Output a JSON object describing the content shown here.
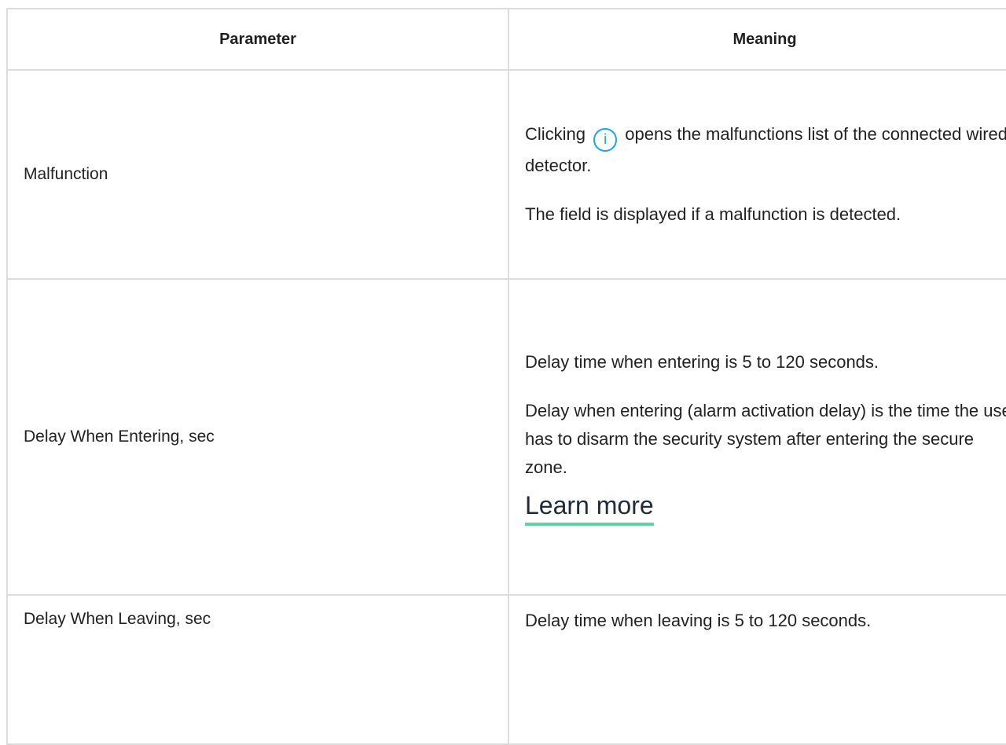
{
  "table": {
    "headers": {
      "parameter": "Parameter",
      "meaning": "Meaning"
    },
    "rows": [
      {
        "parameter": "Malfunction",
        "meaning": {
          "clicking": "Clicking",
          "after_icon": "opens the malfunctions list of the connected wired detector.",
          "paragraph2": "The field is displayed if a malfunction is detected."
        },
        "icon": "info-circle-icon"
      },
      {
        "parameter": "Delay When Entering, sec",
        "meaning": {
          "paragraph1": "Delay time when entering is 5 to 120 seconds.",
          "paragraph2": "Delay when entering (alarm activation delay) is the time the user has to disarm the security system after entering the secure zone.",
          "link": "Learn more"
        }
      },
      {
        "parameter": "Delay When Leaving, sec",
        "meaning": {
          "paragraph1": "Delay time when leaving is 5 to 120 seconds."
        }
      }
    ]
  },
  "colors": {
    "info_icon": "#1da1f2",
    "link_underline": "#5cd6a0",
    "border": "#dcdcdc"
  }
}
